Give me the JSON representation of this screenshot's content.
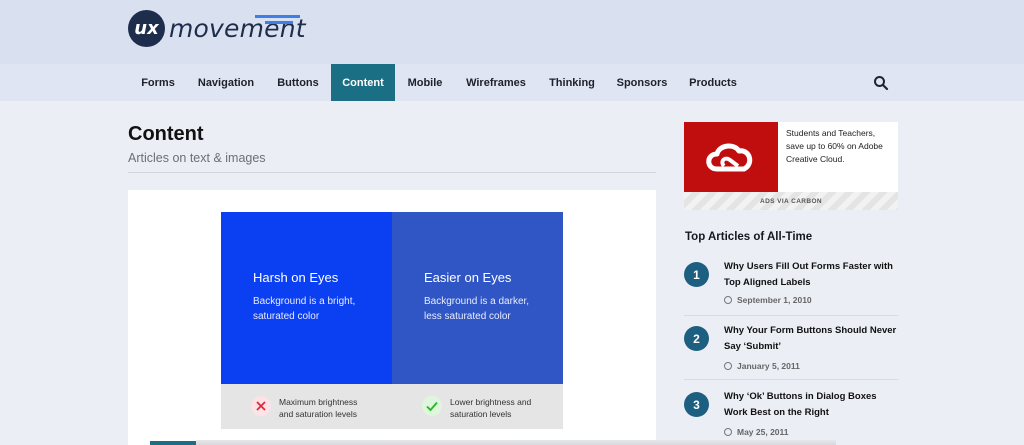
{
  "brand": {
    "mark": "ux",
    "name": "movement"
  },
  "nav": {
    "items": [
      {
        "label": "Forms"
      },
      {
        "label": "Navigation"
      },
      {
        "label": "Buttons"
      },
      {
        "label": "Content",
        "active": true
      },
      {
        "label": "Mobile"
      },
      {
        "label": "Wireframes"
      },
      {
        "label": "Thinking"
      },
      {
        "label": "Sponsors"
      },
      {
        "label": "Products"
      }
    ],
    "search_icon": "search-icon"
  },
  "page": {
    "title": "Content",
    "subtitle": "Articles on text & images"
  },
  "feature_image": {
    "left": {
      "title": "Harsh on Eyes",
      "body_line1": "Background is a bright,",
      "body_line2": "saturated color",
      "color": "#0b3ff2"
    },
    "right": {
      "title": "Easier on Eyes",
      "body_line1": "Background is a darker,",
      "body_line2": "less saturated color",
      "color": "#2f56c4"
    },
    "bad": {
      "icon": "x-icon",
      "line1": "Maximum brightness",
      "line2": "and saturation levels"
    },
    "good": {
      "icon": "check-icon",
      "line1": "Lower brightness and",
      "line2": "saturation levels"
    }
  },
  "ad": {
    "logo_icon": "creative-cloud-icon",
    "text": "Students and Teachers, save up to 60% on Adobe Creative Cloud.",
    "footer": "ADS VIA CARBON"
  },
  "sidebar": {
    "heading": "Top Articles of All-Time",
    "articles": [
      {
        "num": "1",
        "title": "Why Users Fill Out Forms Faster with Top Aligned Labels",
        "date": "September 1, 2010"
      },
      {
        "num": "2",
        "title": "Why Your Form Buttons Should Never Say ‘Submit’",
        "date": "January 5, 2011"
      },
      {
        "num": "3",
        "title": "Why ‘Ok’ Buttons in Dialog Boxes Work Best on the Right",
        "date": "May 25, 2011"
      }
    ]
  },
  "colors": {
    "accent": "#1b6f85",
    "brand_dark": "#1f2d4d",
    "ad_red": "#c00d0d"
  }
}
